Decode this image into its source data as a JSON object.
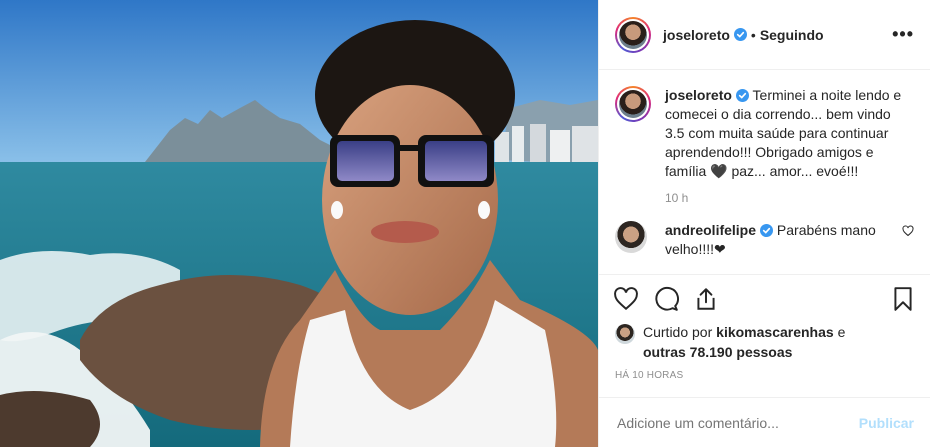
{
  "post": {
    "username": "joseloreto",
    "separator": "•",
    "follow_status": "Seguindo",
    "more_label": "•••",
    "caption_user": "joseloreto",
    "caption": "Terminei a noite lendo e comecei o dia correndo... bem vindo 3.5 com muita saúde para continuar aprendendo!!! Obrigado amigos e família 🖤 paz... amor... evoé!!!",
    "caption_time": "10 h",
    "comments": [
      {
        "user": "andreolifelipe",
        "text": "Parabéns mano velho!!!!❤"
      }
    ],
    "likes": {
      "prefix": "Curtido por",
      "user": "kikomascarenhas",
      "and": "e",
      "others": "outras 78.190 pessoas"
    },
    "posted_ago": "HÁ 10 HORAS",
    "comment_placeholder": "Adicione um comentário...",
    "publish_label": "Publicar"
  },
  "colors": {
    "verified": "#3897f0",
    "publish_disabled": "#b2dffc",
    "muted": "#8e8e8e"
  },
  "icons": [
    "verified-badge-icon",
    "more-options-icon",
    "heart-icon",
    "comment-icon",
    "share-icon",
    "bookmark-icon",
    "small-heart-icon"
  ]
}
